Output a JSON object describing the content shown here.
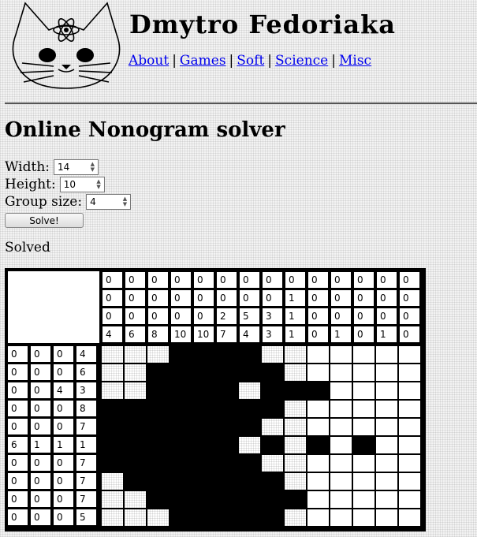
{
  "site": {
    "title": "Dmytro Fedoriaka",
    "nav": [
      "About",
      "Games",
      "Soft",
      "Science",
      "Misc"
    ],
    "nav_separator": "|"
  },
  "page_title": "Online Nonogram solver",
  "form": {
    "width_label": "Width:",
    "width_value": "14",
    "height_label": "Height:",
    "height_value": "10",
    "group_label": "Group size:",
    "group_value": "4",
    "solve_label": "Solve!"
  },
  "status": "Solved",
  "nonogram": {
    "width": 14,
    "height": 10,
    "column_clues": [
      [
        "0",
        "0",
        "0",
        "4"
      ],
      [
        "0",
        "0",
        "0",
        "6"
      ],
      [
        "0",
        "0",
        "0",
        "8"
      ],
      [
        "0",
        "0",
        "0",
        "10"
      ],
      [
        "0",
        "0",
        "0",
        "10"
      ],
      [
        "0",
        "0",
        "2",
        "7"
      ],
      [
        "0",
        "0",
        "5",
        "4"
      ],
      [
        "0",
        "0",
        "3",
        "3"
      ],
      [
        "0",
        "1",
        "1",
        "1"
      ],
      [
        "0",
        "0",
        "0",
        "0"
      ],
      [
        "0",
        "0",
        "0",
        "1"
      ],
      [
        "0",
        "0",
        "0",
        "0"
      ],
      [
        "0",
        "0",
        "0",
        "1"
      ],
      [
        "0",
        "0",
        "0",
        "0"
      ]
    ],
    "row_clues": [
      [
        "0",
        "0",
        "0",
        "4"
      ],
      [
        "0",
        "0",
        "0",
        "6"
      ],
      [
        "0",
        "0",
        "4",
        "3"
      ],
      [
        "0",
        "0",
        "0",
        "8"
      ],
      [
        "0",
        "0",
        "0",
        "7"
      ],
      [
        "6",
        "1",
        "1",
        "1"
      ],
      [
        "0",
        "0",
        "0",
        "7"
      ],
      [
        "0",
        "0",
        "0",
        "7"
      ],
      [
        "0",
        "0",
        "0",
        "7"
      ],
      [
        "0",
        "0",
        "0",
        "5"
      ]
    ],
    "solution": [
      "...####.......",
      "..######......",
      "..####.###....",
      "########......",
      "#######.......",
      "######.#.#.#..",
      "#######.......",
      ".#######......",
      "..#######.....",
      "...#####......"
    ]
  }
}
